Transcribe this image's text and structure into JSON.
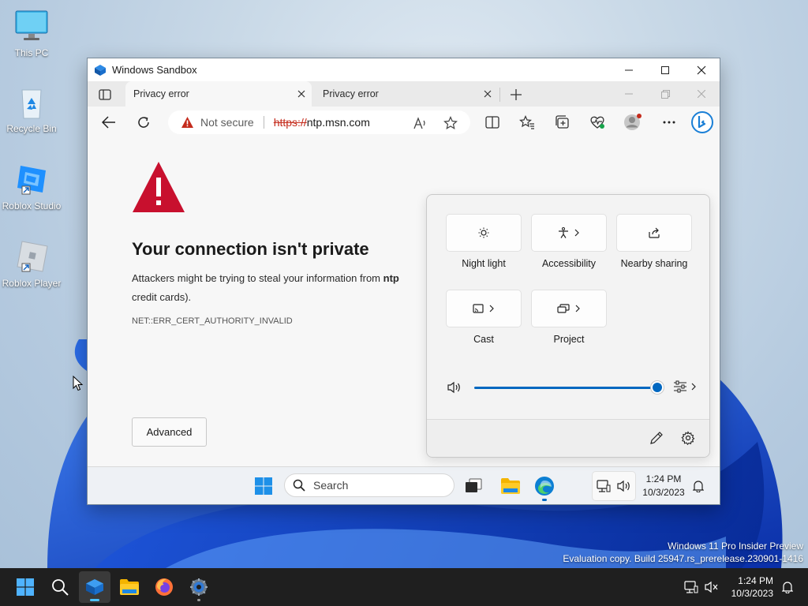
{
  "desktop": {
    "icons": [
      {
        "label": "This PC"
      },
      {
        "label": "Recycle Bin"
      },
      {
        "label": "Roblox Studio"
      },
      {
        "label": "Roblox Player"
      }
    ],
    "watermark": {
      "line1": "Windows 11 Pro Insider Preview",
      "line2": "Evaluation copy. Build 25947.rs_prerelease.230901-1416"
    }
  },
  "sandbox": {
    "title": "Windows Sandbox",
    "colors": {
      "accent": "#0067c0",
      "danger": "#c42b1c"
    }
  },
  "browser": {
    "tabs": [
      {
        "label": "Privacy error",
        "active": true
      },
      {
        "label": "Privacy error",
        "active": false
      }
    ],
    "address": {
      "security_label": "Not secure",
      "scheme": "https://",
      "host": "ntp.msn.com"
    },
    "page": {
      "title": "Your connection isn't private",
      "desc_prefix": "Attackers might be trying to steal your information from ",
      "desc_bold": "ntp",
      "desc_line2": "credit cards).",
      "error_code": "NET::ERR_CERT_AUTHORITY_INVALID",
      "advanced_label": "Advanced"
    }
  },
  "quick_settings": {
    "tiles": [
      {
        "label": "Night light",
        "icon": "brightness-icon"
      },
      {
        "label": "Accessibility",
        "icon": "accessibility-icon"
      },
      {
        "label": "Nearby sharing",
        "icon": "share-icon"
      },
      {
        "label": "Cast",
        "icon": "cast-icon"
      },
      {
        "label": "Project",
        "icon": "project-icon"
      }
    ],
    "volume": 100
  },
  "sandbox_taskbar": {
    "search_placeholder": "Search",
    "time": "1:24 PM",
    "date": "10/3/2023"
  },
  "host_taskbar": {
    "time": "1:24 PM",
    "date": "10/3/2023"
  }
}
